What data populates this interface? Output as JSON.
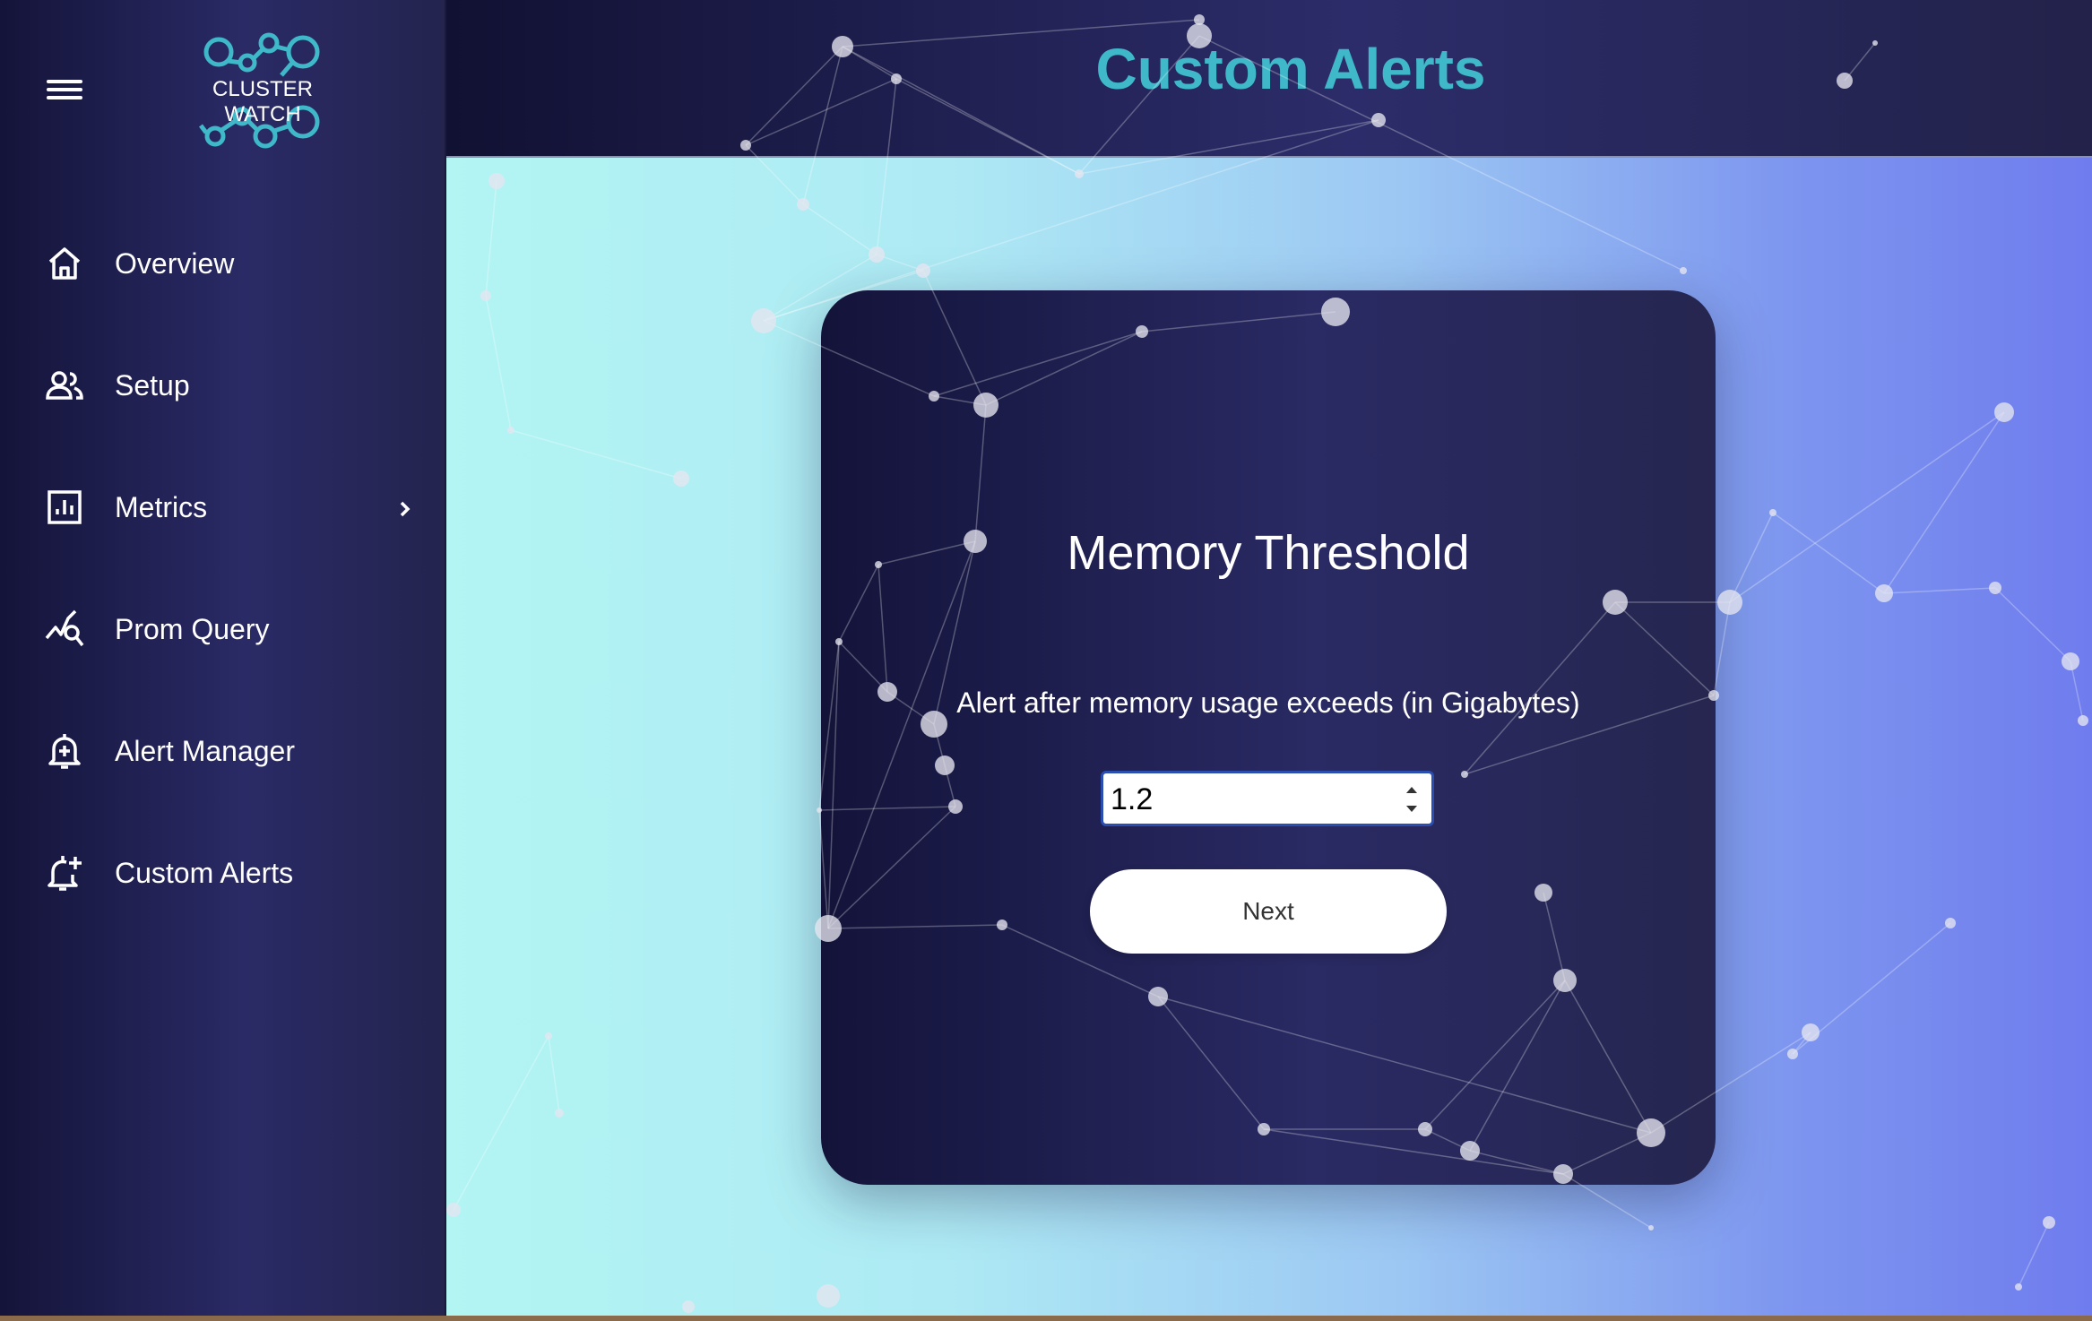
{
  "app": {
    "logo_text": "CLUSTER WATCH"
  },
  "sidebar": {
    "items": [
      {
        "label": "Overview",
        "icon": "home-icon"
      },
      {
        "label": "Setup",
        "icon": "users-icon"
      },
      {
        "label": "Metrics",
        "icon": "chart-icon",
        "has_submenu": true
      },
      {
        "label": "Prom Query",
        "icon": "query-icon"
      },
      {
        "label": "Alert Manager",
        "icon": "alert-bell-icon"
      },
      {
        "label": "Custom Alerts",
        "icon": "add-alert-icon"
      }
    ]
  },
  "header": {
    "title": "Custom Alerts",
    "title_color": "#3fb8c9"
  },
  "card": {
    "title": "Memory Threshold",
    "description": "Alert after memory usage exceeds (in Gigabytes)",
    "input_value": "1.2",
    "next_label": "Next"
  }
}
